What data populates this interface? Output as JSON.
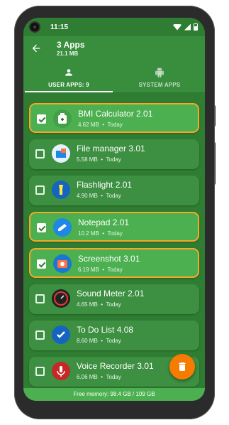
{
  "status_bar": {
    "time": "11:15"
  },
  "app_bar": {
    "title": "3 Apps",
    "subtitle": "21.1 MB"
  },
  "tabs": [
    {
      "label": "USER APPS: 9",
      "icon": "person-icon",
      "active": true
    },
    {
      "label": "SYSTEM APPS",
      "icon": "android-icon",
      "active": false
    }
  ],
  "apps": [
    {
      "name": "BMI Calculator 2.01",
      "size": "4.62 MB",
      "date": "Today",
      "selected": true,
      "icon": "bmi-calculator-icon"
    },
    {
      "name": "File manager 3.01",
      "size": "5.58 MB",
      "date": "Today",
      "selected": false,
      "icon": "file-manager-icon"
    },
    {
      "name": "Flashlight 2.01",
      "size": "4.90 MB",
      "date": "Today",
      "selected": false,
      "icon": "flashlight-icon"
    },
    {
      "name": "Notepad 2.01",
      "size": "10.2 MB",
      "date": "Today",
      "selected": true,
      "icon": "notepad-icon"
    },
    {
      "name": "Screenshot 3.01",
      "size": "6.19 MB",
      "date": "Today",
      "selected": true,
      "icon": "screenshot-icon"
    },
    {
      "name": "Sound Meter 2.01",
      "size": "4.65 MB",
      "date": "Today",
      "selected": false,
      "icon": "sound-meter-icon"
    },
    {
      "name": "To Do List 4.08",
      "size": "8.60 MB",
      "date": "Today",
      "selected": false,
      "icon": "todo-list-icon"
    },
    {
      "name": "Voice Recorder 3.01",
      "size": "6.06 MB",
      "date": "Today",
      "selected": false,
      "icon": "voice-recorder-icon"
    }
  ],
  "meta_separator": "•",
  "footer": {
    "free_memory": "Free memory: 98.4 GB / 109 GB"
  },
  "colors": {
    "primary": "#388e3c",
    "accent": "#f57c00",
    "selection_border": "#f9a825"
  }
}
